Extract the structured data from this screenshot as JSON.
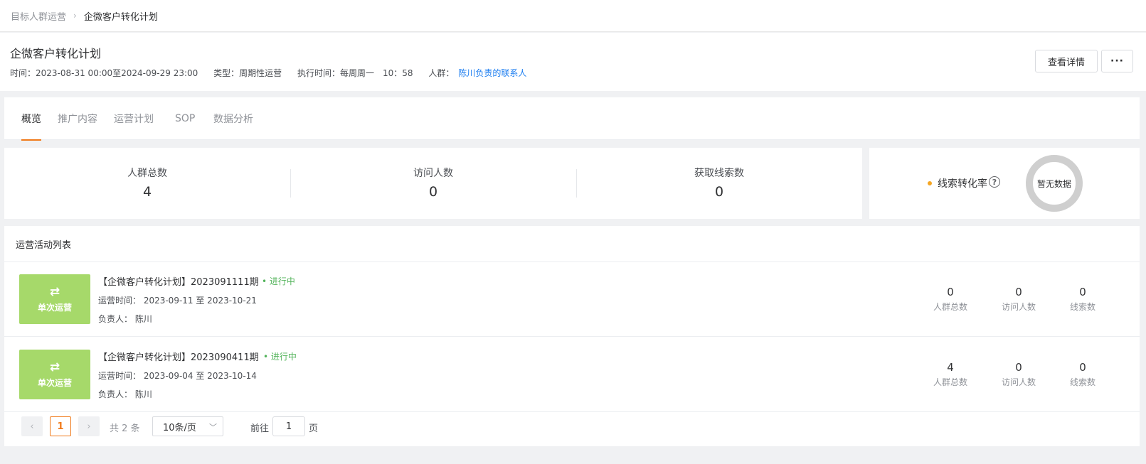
{
  "breadcrumb": {
    "parent": "目标人群运营",
    "separator": "›",
    "current": "企微客户转化计划"
  },
  "header": {
    "title": "企微客户转化计划",
    "time": "时间：2023-08-31 00:00至2024-09-29 23:00",
    "type": "类型：周期性运营",
    "exec_time": "执行时间：每周周一　10：58",
    "audience_label": "人群：",
    "audience_value": "陈川负责的联系人",
    "detail_button": "查看详情",
    "more_button": "···"
  },
  "tabs": [
    {
      "label": "概览",
      "active": true
    },
    {
      "label": "推广内容",
      "active": false
    },
    {
      "label": "运营计划",
      "active": false
    },
    {
      "label": "SOP",
      "active": false
    },
    {
      "label": "数据分析",
      "active": false
    }
  ],
  "stats": [
    {
      "label": "人群总数",
      "value": "4"
    },
    {
      "label": "访问人数",
      "value": "0"
    },
    {
      "label": "获取线索数",
      "value": "0"
    }
  ],
  "rate": {
    "label": "线索转化率",
    "help": "?",
    "empty_text": "暂无数据",
    "dot_color": "#f5a623"
  },
  "activity_list": {
    "title": "运营活动列表",
    "items": [
      {
        "badge_icon": "⇄",
        "badge_text": "单次运营",
        "title": "【企微客户转化计划】2023091111期",
        "status": "• 进行中",
        "time": "运营时间：  2023-09-11 至 2023-10-21",
        "owner": "负责人：  陈川",
        "stats": [
          {
            "value": "0",
            "label": "人群总数"
          },
          {
            "value": "0",
            "label": "访问人数"
          },
          {
            "value": "0",
            "label": "线索数"
          }
        ]
      },
      {
        "badge_icon": "⇄",
        "badge_text": "单次运营",
        "title": "【企微客户转化计划】2023090411期",
        "status": "• 进行中",
        "time": "运营时间：  2023-09-04 至 2023-10-14",
        "owner": "负责人：  陈川",
        "stats": [
          {
            "value": "4",
            "label": "人群总数"
          },
          {
            "value": "0",
            "label": "访问人数"
          },
          {
            "value": "0",
            "label": "线索数"
          }
        ]
      }
    ]
  },
  "pagination": {
    "prev": "‹",
    "current_page": "1",
    "next": "›",
    "total": "共 2 条",
    "page_size": "10条/页",
    "goto_label": "前往",
    "goto_value": "1",
    "page_suffix": "页"
  },
  "colors": {
    "accent": "#f07a1a",
    "badge": "#a6d96a",
    "status": "#52b35a",
    "link": "#1a7cf0"
  }
}
